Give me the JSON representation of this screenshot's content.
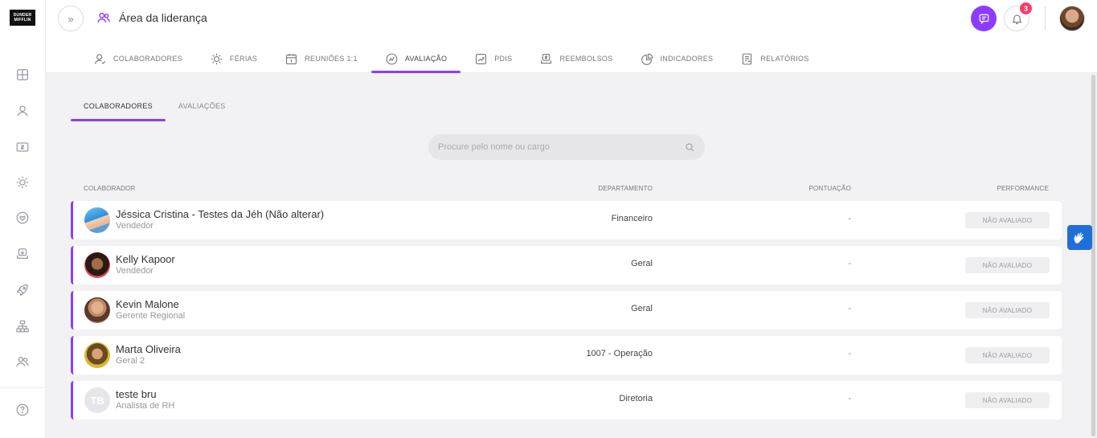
{
  "logo": {
    "text": "DUNDER MIFFLIN"
  },
  "header": {
    "title": "Área da liderança",
    "notifications_count": "3"
  },
  "top_tabs": [
    {
      "label": "COLABORADORES",
      "icon": "user-icon"
    },
    {
      "label": "FÉRIAS",
      "icon": "sun-icon"
    },
    {
      "label": "REUNIÕES 1:1",
      "icon": "calendar-icon"
    },
    {
      "label": "AVALIAÇÃO",
      "icon": "evaluation-icon",
      "active": true
    },
    {
      "label": "PDIS",
      "icon": "chart-trend-icon"
    },
    {
      "label": "REEMBOLSOS",
      "icon": "money-icon"
    },
    {
      "label": "INDICADORES",
      "icon": "pie-chart-icon"
    },
    {
      "label": "RELATÓRIOS",
      "icon": "report-icon"
    }
  ],
  "sub_tabs": [
    {
      "label": "COLABORADORES",
      "active": true
    },
    {
      "label": "AVALIAÇÕES"
    }
  ],
  "search": {
    "placeholder": "Procure pelo nome ou cargo",
    "value": ""
  },
  "columns": {
    "collaborator": "COLABORADOR",
    "department": "DEPARTAMENTO",
    "score": "PONTUAÇÃO",
    "performance": "PERFORMANCE"
  },
  "rows": [
    {
      "name": "Jéssica Cristina - Testes da Jéh (Não alterar)",
      "role": "Vendedor",
      "department": "Financeiro",
      "score": "-",
      "performance": "NÃO AVALIADO",
      "avatar_initials": ""
    },
    {
      "name": "Kelly Kapoor",
      "role": "Vendedor",
      "department": "Geral",
      "score": "-",
      "performance": "NÃO AVALIADO",
      "avatar_initials": ""
    },
    {
      "name": "Kevin Malone",
      "role": "Gerente Regional",
      "department": "Geral",
      "score": "-",
      "performance": "NÃO AVALIADO",
      "avatar_initials": ""
    },
    {
      "name": "Marta Oliveira",
      "role": "Geral 2",
      "department": "1007 - Operação",
      "score": "-",
      "performance": "NÃO AVALIADO",
      "avatar_initials": ""
    },
    {
      "name": "teste bru",
      "role": "Analista de RH",
      "department": "Diretoria",
      "score": "-",
      "performance": "NÃO AVALIADO",
      "avatar_initials": "TB"
    }
  ],
  "colors": {
    "accent": "#8b3dff",
    "badge": "#ff3b6b",
    "a11y": "#1f6fd8"
  }
}
